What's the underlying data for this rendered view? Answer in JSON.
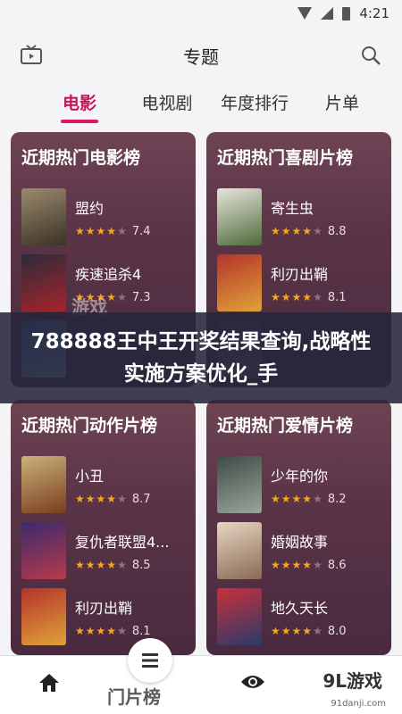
{
  "status": {
    "time": "4:21"
  },
  "header": {
    "title": "专题"
  },
  "tabs": [
    {
      "label": "电影"
    },
    {
      "label": "电视剧"
    },
    {
      "label": "年度排行"
    },
    {
      "label": "片单"
    }
  ],
  "cards": [
    {
      "title": "近期热门电影榜",
      "movies": [
        {
          "name": "盟约",
          "score": "7.4",
          "stars": 4,
          "poster": [
            "#9b8a6e",
            "#3a3226"
          ]
        },
        {
          "name": "疾速追杀4",
          "score": "7.3",
          "stars": 4,
          "poster": [
            "#2b2c3a",
            "#a8232b"
          ]
        },
        {
          "name": "",
          "score": "",
          "stars": 0,
          "poster": [
            "#3d6ea8",
            "#8fb8d8"
          ]
        }
      ]
    },
    {
      "title": "近期热门喜剧片榜",
      "movies": [
        {
          "name": "寄生虫",
          "score": "8.8",
          "stars": 4,
          "poster": [
            "#e8e5dc",
            "#4d6b3a"
          ]
        },
        {
          "name": "利刃出鞘",
          "score": "8.1",
          "stars": 4,
          "poster": [
            "#b3342a",
            "#e0a23a"
          ]
        },
        {
          "name": "",
          "score": "",
          "stars": 0,
          "poster": [
            "#50405a",
            "#7a6a80"
          ]
        }
      ]
    },
    {
      "title": "近期热门动作片榜",
      "movies": [
        {
          "name": "小丑",
          "score": "8.7",
          "stars": 4,
          "poster": [
            "#c9b27a",
            "#7a3d1e"
          ]
        },
        {
          "name": "复仇者联盟4...",
          "score": "8.5",
          "stars": 4,
          "poster": [
            "#3a2a6e",
            "#b83a4a"
          ]
        },
        {
          "name": "利刃出鞘",
          "score": "8.1",
          "stars": 4,
          "poster": [
            "#b3342a",
            "#e0a23a"
          ]
        }
      ]
    },
    {
      "title": "近期热门爱情片榜",
      "movies": [
        {
          "name": "少年的你",
          "score": "8.2",
          "stars": 4,
          "poster": [
            "#3e4a44",
            "#9aa69c"
          ]
        },
        {
          "name": "婚姻故事",
          "score": "8.6",
          "stars": 4,
          "poster": [
            "#e6d6c2",
            "#8a6a54"
          ]
        },
        {
          "name": "地久天长",
          "score": "8.0",
          "stars": 4,
          "poster": [
            "#c8303a",
            "#2a3a6a"
          ]
        }
      ]
    }
  ],
  "banner": {
    "text": "788888王中王开奖结果查询,战略性实施方案优化_手",
    "watermark": "游戏"
  },
  "bottom_nav": {
    "label": "门片榜"
  },
  "logo": {
    "text": "9L游戏",
    "url": "91danji.com"
  },
  "colors": {
    "accent": "#d81b60",
    "star": "#f5a623"
  }
}
